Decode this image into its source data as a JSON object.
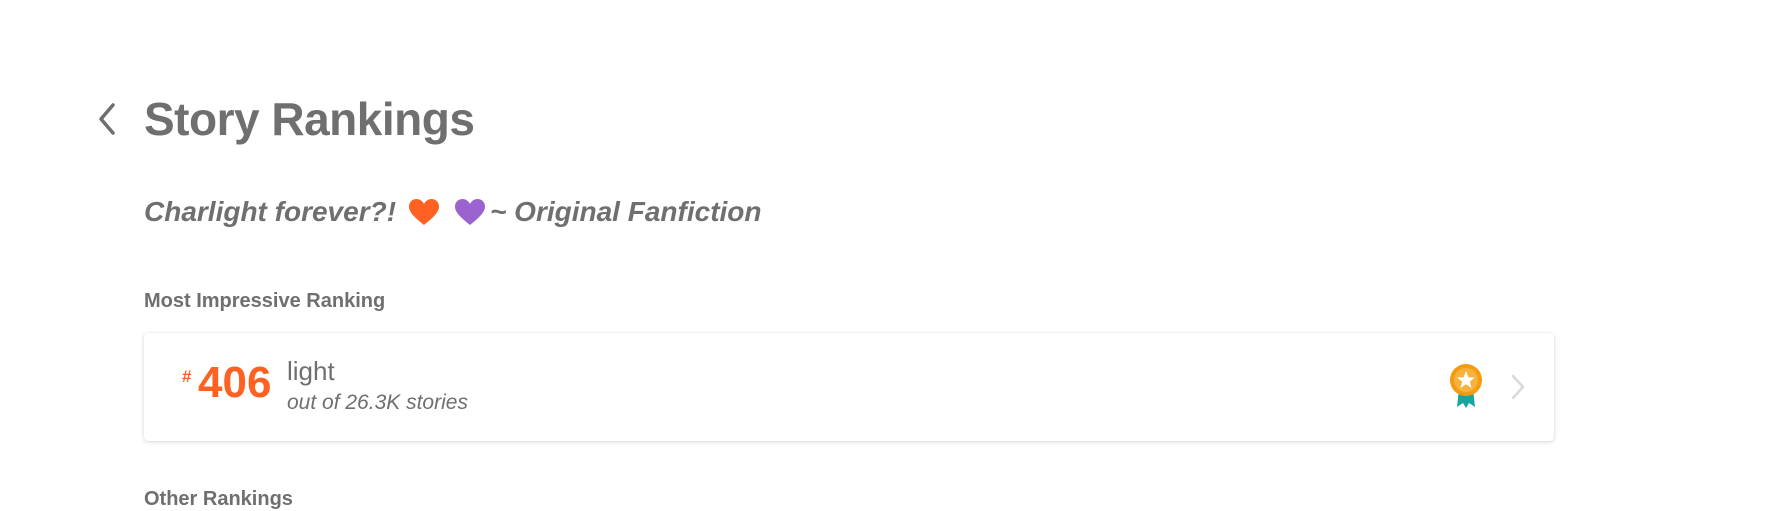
{
  "header": {
    "back_icon": "chevron-left-icon",
    "title": "Story Rankings"
  },
  "story": {
    "title_prefix": "Charlight forever?!",
    "title_suffix": "~ Original Fanfiction",
    "heart_colors": [
      "#ff6122",
      "#9b63d0"
    ]
  },
  "most_impressive": {
    "section_label": "Most Impressive Ranking",
    "hash": "#",
    "rank": "406",
    "tag": "light",
    "subtitle": "out of 26.3K stories",
    "badge_icon": "award-medal-icon",
    "chevron_icon": "chevron-right-icon"
  },
  "other": {
    "section_label": "Other Rankings"
  },
  "colors": {
    "accent": "#ff6122",
    "text": "#6f6f6f",
    "badge_orange": "#f39c12",
    "badge_teal": "#16a5a1"
  }
}
